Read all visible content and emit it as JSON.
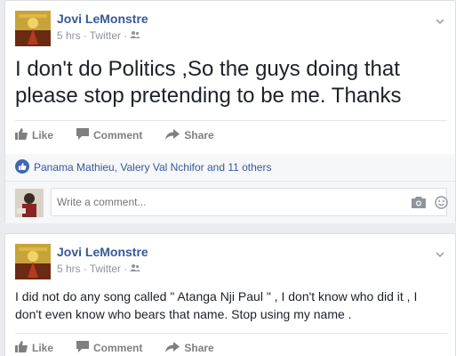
{
  "posts": [
    {
      "author": "Jovi LeMonstre",
      "time": "5 hrs",
      "separator": "·",
      "source": "Twitter",
      "separator2": "·",
      "text": "I don't do Politics ,So the guys doing that please stop pretending to be me. Thanks",
      "actions": {
        "like": "Like",
        "comment": "Comment",
        "share": "Share"
      },
      "likes_text": "Panama Mathieu, Valery Val Nchifor and 11 others",
      "comment_placeholder": "Write a comment..."
    },
    {
      "author": "Jovi LeMonstre",
      "time": "5 hrs",
      "separator": "·",
      "source": "Twitter",
      "separator2": "·",
      "text": "I did not do any song called \" Atanga Nji Paul \" , I don't know who did it , I don't even know who bears that name. Stop using my name .",
      "actions": {
        "like": "Like",
        "comment": "Comment",
        "share": "Share"
      }
    }
  ],
  "colors": {
    "link": "#365899",
    "meta": "#90949c",
    "like_blue": "#4267b2",
    "background": "#e9ebee"
  },
  "icons": [
    "friends-audience-icon",
    "chevron-down-icon",
    "like-thumb-icon",
    "comment-bubble-icon",
    "share-arrow-icon",
    "like-reaction-icon",
    "camera-icon",
    "emoji-icon"
  ]
}
